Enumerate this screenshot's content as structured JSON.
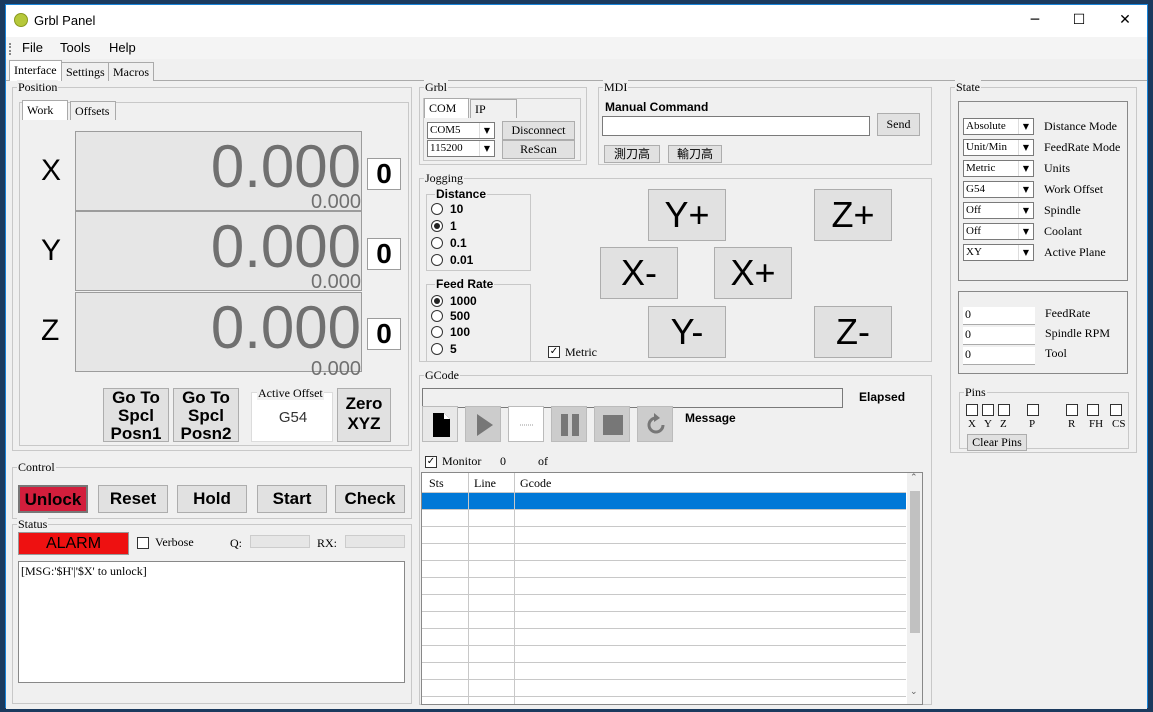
{
  "window": {
    "title": "Grbl Panel",
    "minimize": "─",
    "maximize": "☐",
    "close": "✕"
  },
  "menu": [
    "File",
    "Tools",
    "Help"
  ],
  "tabs": [
    "Interface",
    "Settings",
    "Macros"
  ],
  "position": {
    "title": "Position",
    "tabs": [
      "Work",
      "Offsets"
    ],
    "axes": [
      {
        "name": "X",
        "value": "0.000",
        "machine": "0.000",
        "zero": "0"
      },
      {
        "name": "Y",
        "value": "0.000",
        "machine": "0.000",
        "zero": "0"
      },
      {
        "name": "Z",
        "value": "0.000",
        "machine": "0.000",
        "zero": "0"
      }
    ],
    "goto1": "Go To Spcl Posn1",
    "goto2": "Go To Spcl Posn2",
    "active_offset_label": "Active Offset",
    "active_offset": "G54",
    "zero_xyz": "Zero XYZ"
  },
  "grbl": {
    "title": "Grbl",
    "tabs": [
      "COM",
      "IP"
    ],
    "port": "COM5",
    "baud": "115200",
    "disconnect": "Disconnect",
    "rescan": "ReScan"
  },
  "mdi": {
    "title": "MDI",
    "label": "Manual Command",
    "value": "",
    "send": "Send",
    "macro1": "測刀高",
    "macro2": "輸刀高"
  },
  "jogging": {
    "title": "Jogging",
    "distance_label": "Distance",
    "distances": [
      "10",
      "1",
      "0.1",
      "0.01"
    ],
    "distance_selected": 1,
    "feed_label": "Feed Rate",
    "feeds": [
      "1000",
      "500",
      "100",
      "5"
    ],
    "feed_selected": 0,
    "metric": "Metric",
    "buttons": {
      "yplus": "Y+",
      "zplus": "Z+",
      "xminus": "X-",
      "xplus": "X+",
      "yminus": "Y-",
      "zminus": "Z-"
    }
  },
  "gcode": {
    "title": "GCode",
    "file": "",
    "elapsed": "Elapsed",
    "message": "Message",
    "monitor": "Monitor",
    "count": "0",
    "of": "of",
    "total": "",
    "columns": [
      "Sts",
      "Line",
      "Gcode"
    ],
    "row_count": 12
  },
  "state": {
    "title": "State",
    "items": [
      {
        "value": "Absolute",
        "label": "Distance Mode"
      },
      {
        "value": "Unit/Min",
        "label": "FeedRate Mode"
      },
      {
        "value": "Metric",
        "label": "Units"
      },
      {
        "value": "G54",
        "label": "Work Offset"
      },
      {
        "value": "Off",
        "label": "Spindle"
      },
      {
        "value": "Off",
        "label": "Coolant"
      },
      {
        "value": "XY",
        "label": "Active Plane"
      }
    ],
    "readouts": [
      {
        "value": "0",
        "label": "FeedRate"
      },
      {
        "value": "0",
        "label": "Spindle RPM"
      },
      {
        "value": "0",
        "label": "Tool"
      }
    ],
    "pins_title": "Pins",
    "pins": [
      "X",
      "Y",
      "Z",
      "P",
      "R",
      "FH",
      "CS"
    ],
    "clear_pins": "Clear Pins"
  },
  "control": {
    "title": "Control",
    "buttons": [
      "Unlock",
      "Reset",
      "Hold",
      "Start",
      "Check"
    ],
    "unlock_color": "#d21e3c"
  },
  "status": {
    "title": "Status",
    "alarm": "ALARM",
    "alarm_color": "#ee1111",
    "verbose": "Verbose",
    "q_label": "Q:",
    "rx_label": "RX:",
    "log": "[MSG:'$H'|'$X' to unlock]"
  },
  "colors": {
    "selection": "#0078d7",
    "panel": "#f0f0f0"
  }
}
